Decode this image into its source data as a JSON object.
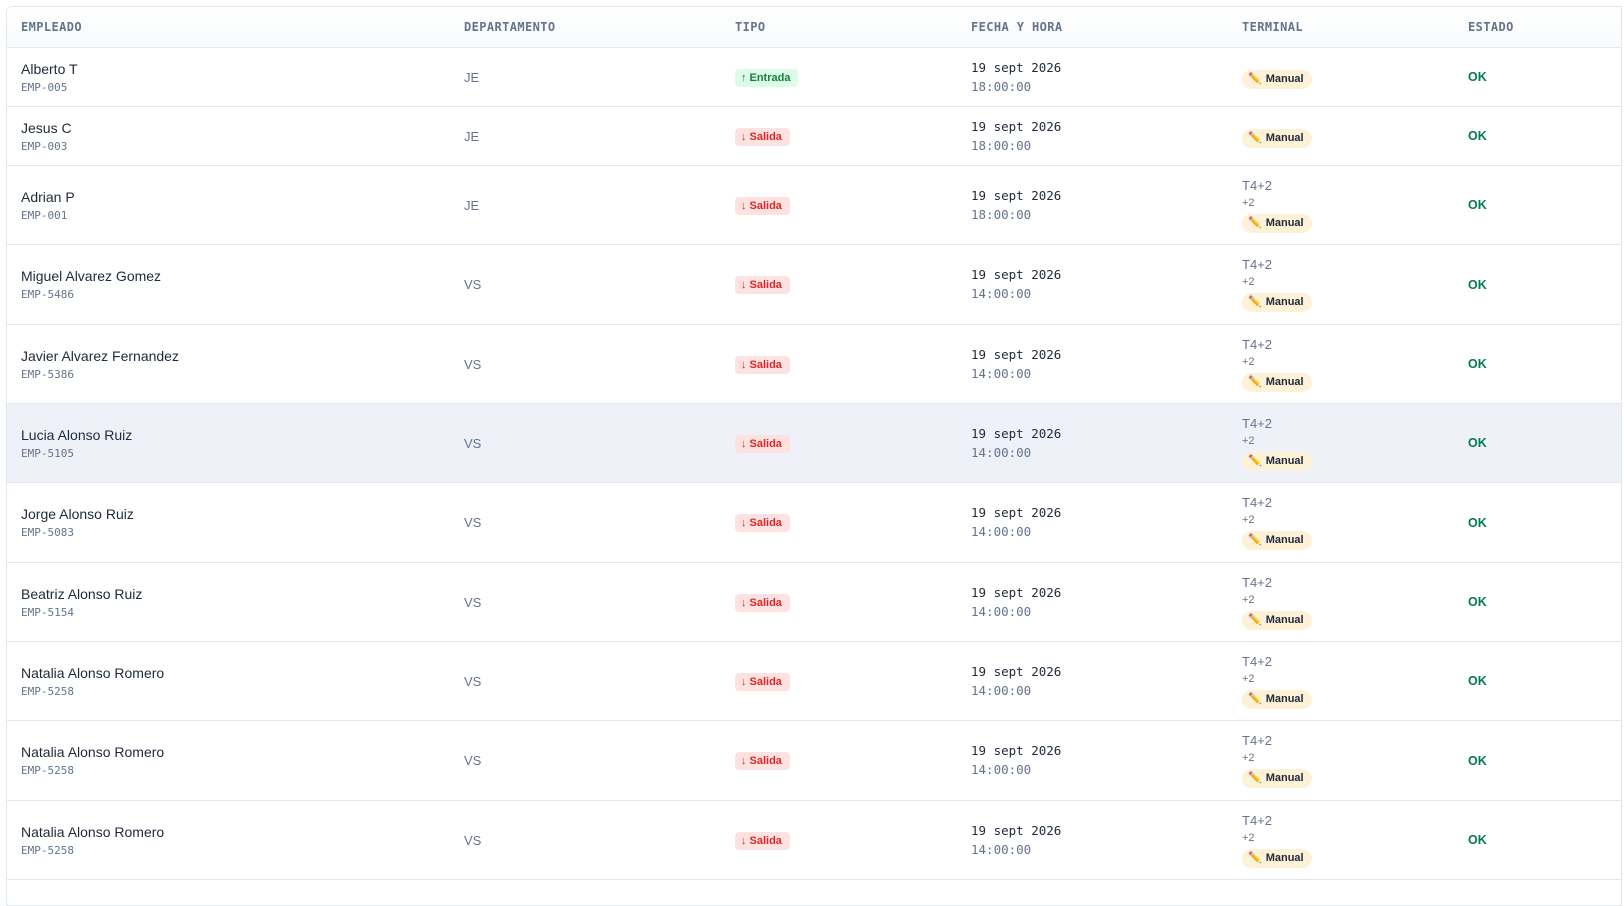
{
  "columns": {
    "empleado": "EMPLEADO",
    "departamento": "DEPARTAMENTO",
    "tipo": "TIPO",
    "fecha": "FECHA Y HORA",
    "terminal": "TERMINAL",
    "estado": "ESTADO"
  },
  "icons": {
    "arrow_in": "↑",
    "arrow_out": "↓",
    "pencil": "✏️"
  },
  "colors": {
    "entrada_bg": "#dcfce7",
    "entrada_fg": "#15803d",
    "salida_bg": "#fee2e2",
    "salida_fg": "#dc2626",
    "manual_bg": "#fdf1d6",
    "ok": "#047857"
  },
  "rows": [
    {
      "name": "Alberto T",
      "code": "EMP-005",
      "dept": "JE",
      "type": "in",
      "type_label": "Entrada",
      "date": "19 sept 2026",
      "time": "18:00:00",
      "terminal": "",
      "terminal_extra": "",
      "terminal_badge": "Manual",
      "status": "OK"
    },
    {
      "name": "Jesus C",
      "code": "EMP-003",
      "dept": "JE",
      "type": "out",
      "type_label": "Salida",
      "date": "19 sept 2026",
      "time": "18:00:00",
      "terminal": "",
      "terminal_extra": "",
      "terminal_badge": "Manual",
      "status": "OK"
    },
    {
      "name": "Adrian P",
      "code": "EMP-001",
      "dept": "JE",
      "type": "out",
      "type_label": "Salida",
      "date": "19 sept 2026",
      "time": "18:00:00",
      "terminal": "T4+2",
      "terminal_extra": "+2",
      "terminal_badge": "Manual",
      "status": "OK"
    },
    {
      "name": "Miguel Alvarez Gomez",
      "code": "EMP-5486",
      "dept": "VS",
      "type": "out",
      "type_label": "Salida",
      "date": "19 sept 2026",
      "time": "14:00:00",
      "terminal": "T4+2",
      "terminal_extra": "+2",
      "terminal_badge": "Manual",
      "status": "OK"
    },
    {
      "name": "Javier Alvarez Fernandez",
      "code": "EMP-5386",
      "dept": "VS",
      "type": "out",
      "type_label": "Salida",
      "date": "19 sept 2026",
      "time": "14:00:00",
      "terminal": "T4+2",
      "terminal_extra": "+2",
      "terminal_badge": "Manual",
      "status": "OK"
    },
    {
      "name": "Lucia Alonso Ruiz",
      "code": "EMP-5105",
      "dept": "VS",
      "type": "out",
      "type_label": "Salida",
      "date": "19 sept 2026",
      "time": "14:00:00",
      "terminal": "T4+2",
      "terminal_extra": "+2",
      "terminal_badge": "Manual",
      "status": "OK",
      "highlight": true
    },
    {
      "name": "Jorge Alonso Ruiz",
      "code": "EMP-5083",
      "dept": "VS",
      "type": "out",
      "type_label": "Salida",
      "date": "19 sept 2026",
      "time": "14:00:00",
      "terminal": "T4+2",
      "terminal_extra": "+2",
      "terminal_badge": "Manual",
      "status": "OK"
    },
    {
      "name": "Beatriz Alonso Ruiz",
      "code": "EMP-5154",
      "dept": "VS",
      "type": "out",
      "type_label": "Salida",
      "date": "19 sept 2026",
      "time": "14:00:00",
      "terminal": "T4+2",
      "terminal_extra": "+2",
      "terminal_badge": "Manual",
      "status": "OK"
    },
    {
      "name": "Natalia Alonso Romero",
      "code": "EMP-5258",
      "dept": "VS",
      "type": "out",
      "type_label": "Salida",
      "date": "19 sept 2026",
      "time": "14:00:00",
      "terminal": "T4+2",
      "terminal_extra": "+2",
      "terminal_badge": "Manual",
      "status": "OK"
    },
    {
      "name": "Natalia Alonso Romero",
      "code": "EMP-5258",
      "dept": "VS",
      "type": "out",
      "type_label": "Salida",
      "date": "19 sept 2026",
      "time": "14:00:00",
      "terminal": "T4+2",
      "terminal_extra": "+2",
      "terminal_badge": "Manual",
      "status": "OK"
    },
    {
      "name": "Natalia Alonso Romero",
      "code": "EMP-5258",
      "dept": "VS",
      "type": "out",
      "type_label": "Salida",
      "date": "19 sept 2026",
      "time": "14:00:00",
      "terminal": "T4+2",
      "terminal_extra": "+2",
      "terminal_badge": "Manual",
      "status": "OK"
    }
  ]
}
